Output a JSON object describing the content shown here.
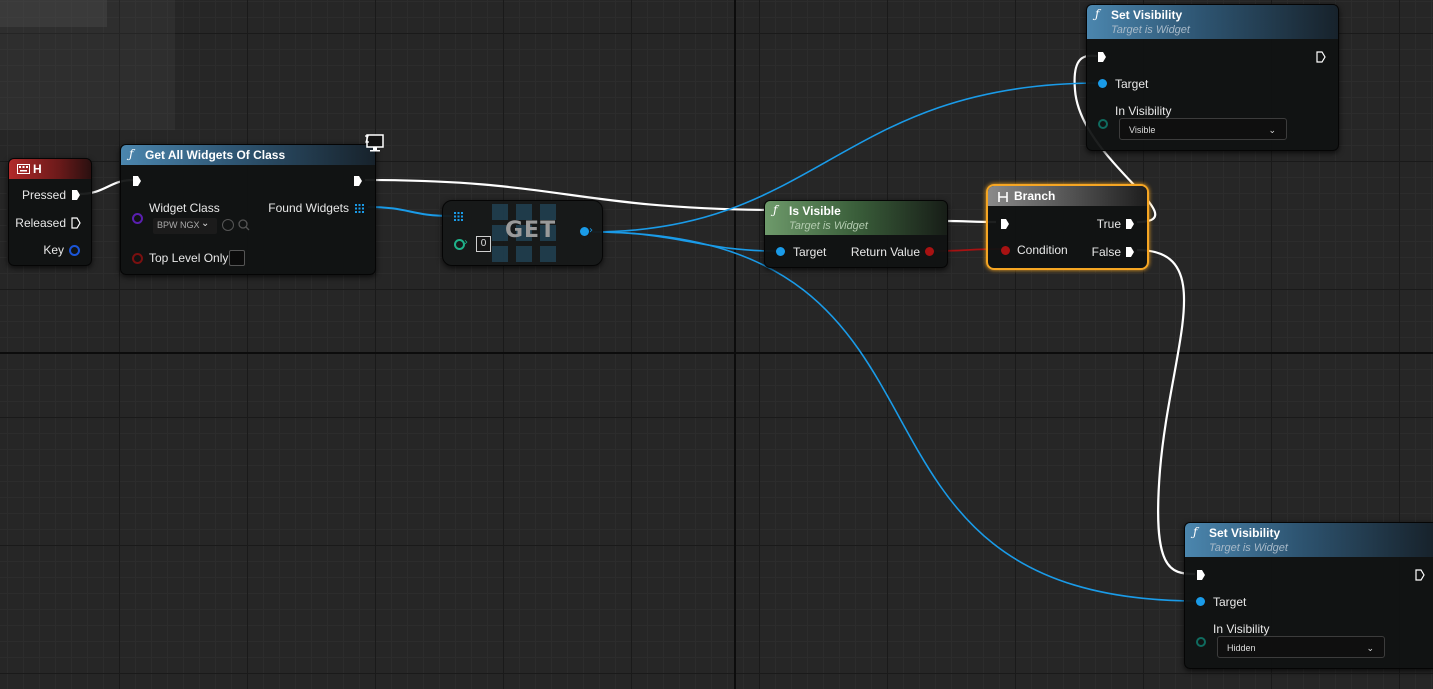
{
  "nodes": {
    "key_event": {
      "title": "H",
      "pins": {
        "pressed": "Pressed",
        "released": "Released",
        "key": "Key"
      }
    },
    "get_all_widgets": {
      "title": "Get All Widgets Of Class",
      "widget_class_label": "Widget Class",
      "widget_class_value": "BPW NGX",
      "found_widgets": "Found Widgets",
      "top_level_only": "Top Level Only"
    },
    "get_array": {
      "title": "GET",
      "index": "0"
    },
    "is_visible": {
      "title": "Is Visible",
      "subtitle": "Target is Widget",
      "target": "Target",
      "return_value": "Return Value"
    },
    "branch": {
      "title": "Branch",
      "condition": "Condition",
      "true_label": "True",
      "false_label": "False"
    },
    "set_visibility_top": {
      "title": "Set Visibility",
      "subtitle": "Target is Widget",
      "target": "Target",
      "in_visibility": "In Visibility",
      "value": "Visible"
    },
    "set_visibility_bottom": {
      "title": "Set Visibility",
      "subtitle": "Target is Widget",
      "target": "Target",
      "in_visibility": "In Visibility",
      "value": "Hidden"
    }
  },
  "colors": {
    "exec": "#ffffff",
    "object": "#1a9be8",
    "boolean": "#a81212",
    "class": "#5a1fb0",
    "select_outline": "#f6a623"
  },
  "icons": [
    "function-icon",
    "keyboard-icon",
    "branch-icon",
    "exec-pin-icon",
    "array-icon",
    "monitor-icon",
    "chevron-down-icon"
  ]
}
